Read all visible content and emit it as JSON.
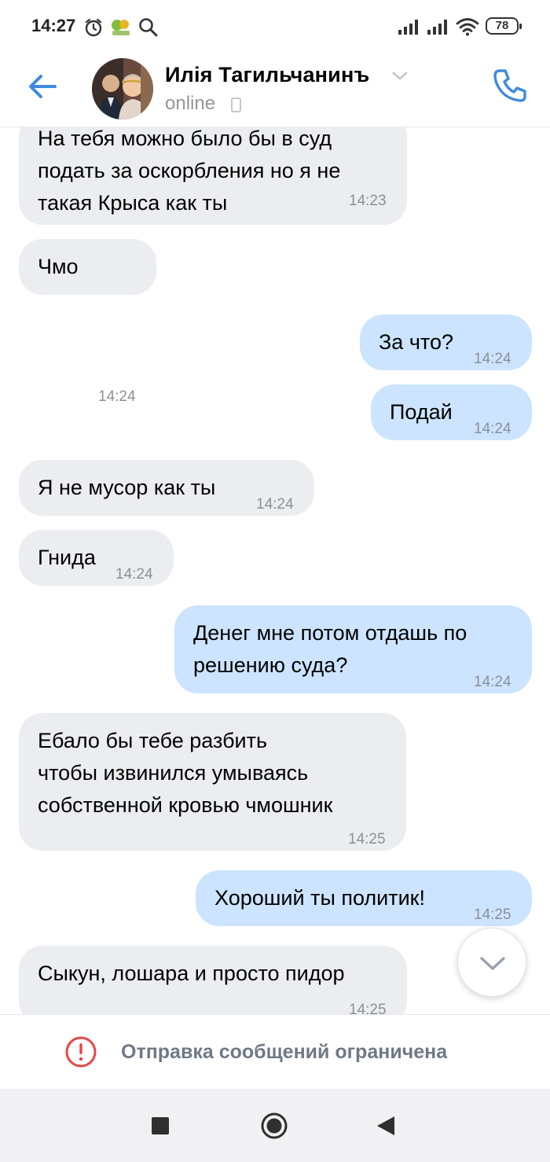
{
  "status_bar": {
    "time": "14:27",
    "battery": "78",
    "icons": [
      "alarm-icon",
      "app-notification-icon",
      "search-icon",
      "signal-icon",
      "signal-icon",
      "wifi-icon",
      "battery-icon"
    ]
  },
  "header": {
    "contact_name": "Илія Тагильчанинъ",
    "presence": "online",
    "icons": [
      "back-arrow-icon",
      "chevron-down-icon",
      "mobile-device-icon",
      "phone-icon"
    ],
    "accent_color": "#3f8ae0"
  },
  "messages": [
    {
      "dir": "in",
      "text": "На тебя можно было бы в суд\nподать за оскорбления но я не\nтакая Крыса как ты",
      "time": "14:23"
    },
    {
      "dir": "in",
      "text": "Чмо",
      "time": "14:24"
    },
    {
      "dir": "out",
      "text": "За что?",
      "time": "14:24"
    },
    {
      "dir": "out",
      "text": "Подай",
      "time": "14:24"
    },
    {
      "dir": "in",
      "text": "Я не мусор как ты",
      "time": "14:24"
    },
    {
      "dir": "in",
      "text": "Гнида",
      "time": "14:24"
    },
    {
      "dir": "out",
      "text": "Денег мне потом отдашь по\nрешению суда?",
      "time": "14:24"
    },
    {
      "dir": "in",
      "text": "Ебало бы тебе разбить\nчтобы извинился умываясь\nсобственной кровью чмошник",
      "time": "14:25"
    },
    {
      "dir": "out",
      "text": "Хороший ты политик!",
      "time": "14:25"
    },
    {
      "dir": "in",
      "text": "Сыкун, лошара и просто пидор",
      "time": "14:25"
    }
  ],
  "colors": {
    "incoming_bubble": "#ebedf0",
    "outgoing_bubble": "#cce4ff",
    "warning": "#e64646"
  },
  "footer": {
    "restriction_text": "Отправка сообщений ограничена",
    "icon": "warning-icon"
  },
  "nav_bar": {
    "icons": [
      "recent-apps-icon",
      "home-icon",
      "back-icon"
    ]
  }
}
